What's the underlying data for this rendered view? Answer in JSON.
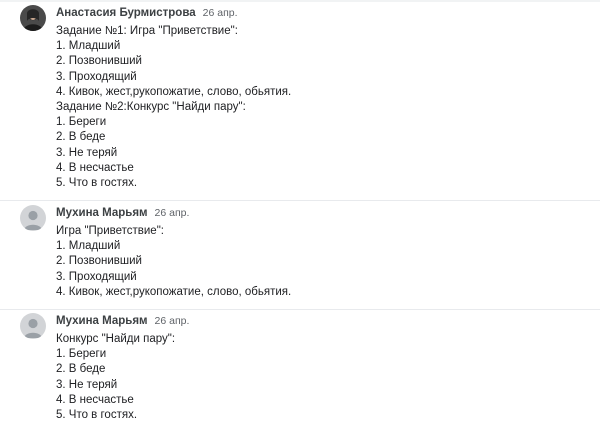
{
  "comments": [
    {
      "author": "Анастасия Бурмистрова",
      "date": "26 апр.",
      "avatar": "photo-avatar",
      "lines": [
        "Задание №1: Игра \"Приветствие\":",
        "1. Младший",
        "2. Позвонивший",
        "3. Проходящий",
        "4. Кивок, жест,рукопожатие, слово, обьятия.",
        "Задание №2:Конкурс \"Найди пару\":",
        "1. Береги",
        "2. В беде",
        "3. Не теряй",
        "4. В несчастье",
        "5. Что в гостях."
      ]
    },
    {
      "author": "Мухина Марьям",
      "date": "26 апр.",
      "avatar": "default-avatar",
      "lines": [
        "Игра \"Приветствие\":",
        "1. Младший",
        "2. Позвонивший",
        "3. Проходящий",
        "4. Кивок, жест,рукопожатие, слово, обьятия."
      ]
    },
    {
      "author": "Мухина Марьям",
      "date": "26 апр.",
      "avatar": "default-avatar",
      "lines": [
        "Конкурс \"Найди пару\":",
        "1. Береги",
        "2. В беде",
        "3. Не теряй",
        "4. В несчастье",
        "5. Что в гостях."
      ]
    }
  ]
}
